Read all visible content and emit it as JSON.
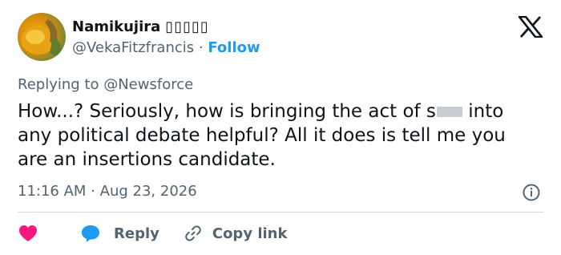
{
  "author": {
    "display_name": "Namikujira",
    "name_glyphs": "▯▯▯▯▯",
    "handle": "@VekaFitzfrancis",
    "separator": "·",
    "follow_label": "Follow"
  },
  "reply_context": {
    "prefix": "Replying to",
    "mention": "@Newsforce"
  },
  "tweet": {
    "text_before": "How...? Seriously, how is bringing the act of s",
    "text_after": "into any political debate helpful? All it does is tell me you are an insertions candidate."
  },
  "meta": {
    "time": "11:16 AM",
    "separator": "·",
    "date": "Aug 23, 2026"
  },
  "actions": {
    "reply_label": "Reply",
    "copy_link_label": "Copy link"
  },
  "colors": {
    "like": "#f91880",
    "reply": "#1d9bf0",
    "link": "#1d9bf0",
    "muted": "#536471",
    "text": "#0f1419"
  },
  "icons": {
    "brand": "x-logo-icon",
    "like": "heart-icon",
    "reply": "speech-bubble-icon",
    "copy": "link-icon",
    "info": "info-icon"
  }
}
